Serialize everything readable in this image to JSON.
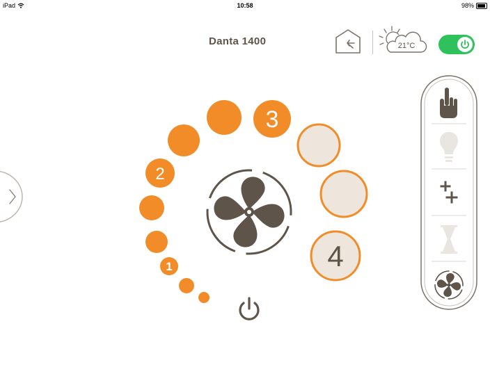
{
  "status_bar": {
    "device": "iPad",
    "time": "10:58",
    "battery": "98%",
    "battery_level": 0.98
  },
  "header": {
    "title": "Danta 1400",
    "home_icon": "home-arrow-icon",
    "weather": {
      "icon": "sun-cloud-icon",
      "temperature": "21°C"
    },
    "power_toggle": {
      "icon": "power-icon",
      "state": "on"
    }
  },
  "side_handle": {
    "icon": "chevron-right-icon"
  },
  "speed_dial": {
    "labels": {
      "low": "1",
      "mid": "2",
      "high": "3",
      "boost": "4"
    },
    "center_icon": "fan-icon",
    "power_icon": "power-icon",
    "colors": {
      "active": "#f28c28",
      "inactive_fill": "#eee6dc",
      "icon": "#5e5449"
    }
  },
  "mode_panel": {
    "items": [
      {
        "name": "manual-mode",
        "icon": "hand-pointer-icon",
        "active": true
      },
      {
        "name": "light-mode",
        "icon": "lightbulb-icon",
        "active": false
      },
      {
        "name": "boost-mode",
        "icon": "plus-plus-icon",
        "active": true
      },
      {
        "name": "timer-mode",
        "icon": "hourglass-icon",
        "active": false
      },
      {
        "name": "fan-mode",
        "icon": "fan-icon",
        "active": true
      }
    ]
  }
}
